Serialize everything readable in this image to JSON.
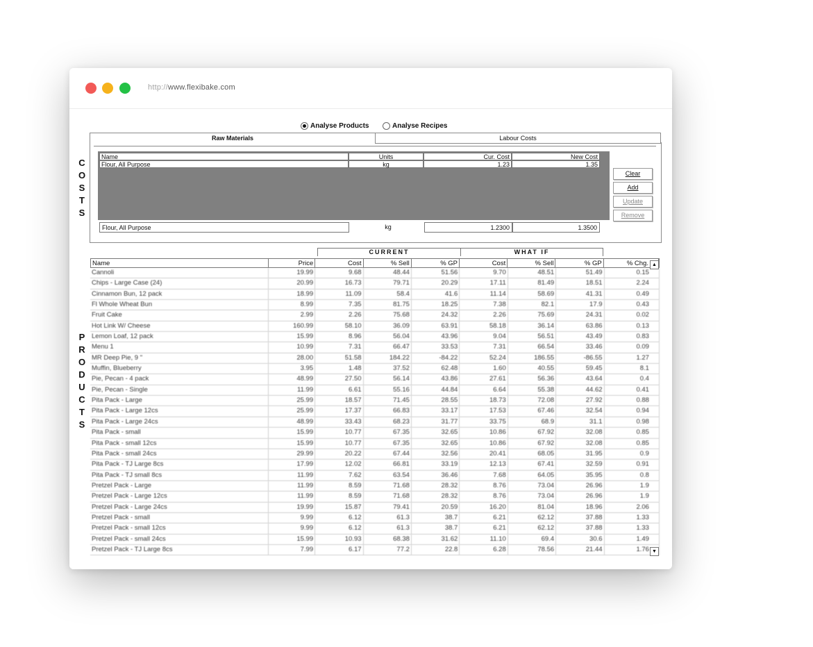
{
  "browser": {
    "url_proto": "http://",
    "url_host": "www.flexibake.com"
  },
  "mode": {
    "analyse_products": "Analyse Products",
    "analyse_recipes": "Analyse Recipes",
    "selected": "analyse_products"
  },
  "tabs": {
    "raw_materials": "Raw Materials",
    "labour_costs": "Labour Costs"
  },
  "costs": {
    "columns": {
      "name": "Name",
      "units": "Units",
      "cur_cost": "Cur. Cost",
      "new_cost": "New Cost"
    },
    "row": {
      "name": "Flour, All Purpose",
      "units": "kg",
      "cur_cost": "1.23",
      "new_cost": "1.35"
    },
    "edit": {
      "name": "Flour, All Purpose",
      "units": "kg",
      "cur_cost": "1.2300",
      "new_cost": "1.3500"
    },
    "buttons": {
      "clear": "Clear",
      "add": "Add",
      "update": "Update",
      "remove": "Remove"
    }
  },
  "side_labels": {
    "costs": [
      "C",
      "O",
      "S",
      "T",
      "S"
    ],
    "products": [
      "P",
      "R",
      "O",
      "D",
      "U",
      "C",
      "T",
      "S"
    ]
  },
  "products": {
    "section_current": "CURRENT",
    "section_whatif": "WHAT IF",
    "columns": [
      "Name",
      "Price",
      "Cost",
      "% Sell",
      "% GP",
      "Cost",
      "% Sell",
      "% GP",
      "% Chg."
    ],
    "rows": [
      [
        "Cannoli",
        "19.99",
        "9.68",
        "48.44",
        "51.56",
        "9.70",
        "48.51",
        "51.49",
        "0.15"
      ],
      [
        "Chips - Large Case (24)",
        "20.99",
        "16.73",
        "79.71",
        "20.29",
        "17.11",
        "81.49",
        "18.51",
        "2.24"
      ],
      [
        "Cinnamon Bun, 12 pack",
        "18.99",
        "11.09",
        "58.4",
        "41.6",
        "11.14",
        "58.69",
        "41.31",
        "0.49"
      ],
      [
        "Fl Whole Wheat Bun",
        "8.99",
        "7.35",
        "81.75",
        "18.25",
        "7.38",
        "82.1",
        "17.9",
        "0.43"
      ],
      [
        "Fruit Cake",
        "2.99",
        "2.26",
        "75.68",
        "24.32",
        "2.26",
        "75.69",
        "24.31",
        "0.02"
      ],
      [
        "Hot Link W/ Cheese",
        "160.99",
        "58.10",
        "36.09",
        "63.91",
        "58.18",
        "36.14",
        "63.86",
        "0.13"
      ],
      [
        "Lemon Loaf, 12 pack",
        "15.99",
        "8.96",
        "56.04",
        "43.96",
        "9.04",
        "56.51",
        "43.49",
        "0.83"
      ],
      [
        "Menu 1",
        "10.99",
        "7.31",
        "66.47",
        "33.53",
        "7.31",
        "66.54",
        "33.46",
        "0.09"
      ],
      [
        "MR Deep Pie, 9 \"",
        "28.00",
        "51.58",
        "184.22",
        "-84.22",
        "52.24",
        "186.55",
        "-86.55",
        "1.27"
      ],
      [
        "Muffin, Blueberry",
        "3.95",
        "1.48",
        "37.52",
        "62.48",
        "1.60",
        "40.55",
        "59.45",
        "8.1"
      ],
      [
        "Pie, Pecan - 4 pack",
        "48.99",
        "27.50",
        "56.14",
        "43.86",
        "27.61",
        "56.36",
        "43.64",
        "0.4"
      ],
      [
        "Pie, Pecan - Single",
        "11.99",
        "6.61",
        "55.16",
        "44.84",
        "6.64",
        "55.38",
        "44.62",
        "0.41"
      ],
      [
        "Pita Pack - Large",
        "25.99",
        "18.57",
        "71.45",
        "28.55",
        "18.73",
        "72.08",
        "27.92",
        "0.88"
      ],
      [
        "Pita Pack - Large 12cs",
        "25.99",
        "17.37",
        "66.83",
        "33.17",
        "17.53",
        "67.46",
        "32.54",
        "0.94"
      ],
      [
        "Pita Pack - Large 24cs",
        "48.99",
        "33.43",
        "68.23",
        "31.77",
        "33.75",
        "68.9",
        "31.1",
        "0.98"
      ],
      [
        "Pita Pack - small",
        "15.99",
        "10.77",
        "67.35",
        "32.65",
        "10.86",
        "67.92",
        "32.08",
        "0.85"
      ],
      [
        "Pita Pack - small 12cs",
        "15.99",
        "10.77",
        "67.35",
        "32.65",
        "10.86",
        "67.92",
        "32.08",
        "0.85"
      ],
      [
        "Pita Pack - small 24cs",
        "29.99",
        "20.22",
        "67.44",
        "32.56",
        "20.41",
        "68.05",
        "31.95",
        "0.9"
      ],
      [
        "Pita Pack - TJ Large 8cs",
        "17.99",
        "12.02",
        "66.81",
        "33.19",
        "12.13",
        "67.41",
        "32.59",
        "0.91"
      ],
      [
        "Pita Pack - TJ small 8cs",
        "11.99",
        "7.62",
        "63.54",
        "36.46",
        "7.68",
        "64.05",
        "35.95",
        "0.8"
      ],
      [
        "Pretzel Pack - Large",
        "11.99",
        "8.59",
        "71.68",
        "28.32",
        "8.76",
        "73.04",
        "26.96",
        "1.9"
      ],
      [
        "Pretzel Pack - Large 12cs",
        "11.99",
        "8.59",
        "71.68",
        "28.32",
        "8.76",
        "73.04",
        "26.96",
        "1.9"
      ],
      [
        "Pretzel Pack - Large 24cs",
        "19.99",
        "15.87",
        "79.41",
        "20.59",
        "16.20",
        "81.04",
        "18.96",
        "2.06"
      ],
      [
        "Pretzel Pack - small",
        "9.99",
        "6.12",
        "61.3",
        "38.7",
        "6.21",
        "62.12",
        "37.88",
        "1.33"
      ],
      [
        "Pretzel Pack - small 12cs",
        "9.99",
        "6.12",
        "61.3",
        "38.7",
        "6.21",
        "62.12",
        "37.88",
        "1.33"
      ],
      [
        "Pretzel Pack - small 24cs",
        "15.99",
        "10.93",
        "68.38",
        "31.62",
        "11.10",
        "69.4",
        "30.6",
        "1.49"
      ],
      [
        "Pretzel Pack - TJ Large 8cs",
        "7.99",
        "6.17",
        "77.2",
        "22.8",
        "6.28",
        "78.56",
        "21.44",
        "1.76"
      ]
    ]
  }
}
